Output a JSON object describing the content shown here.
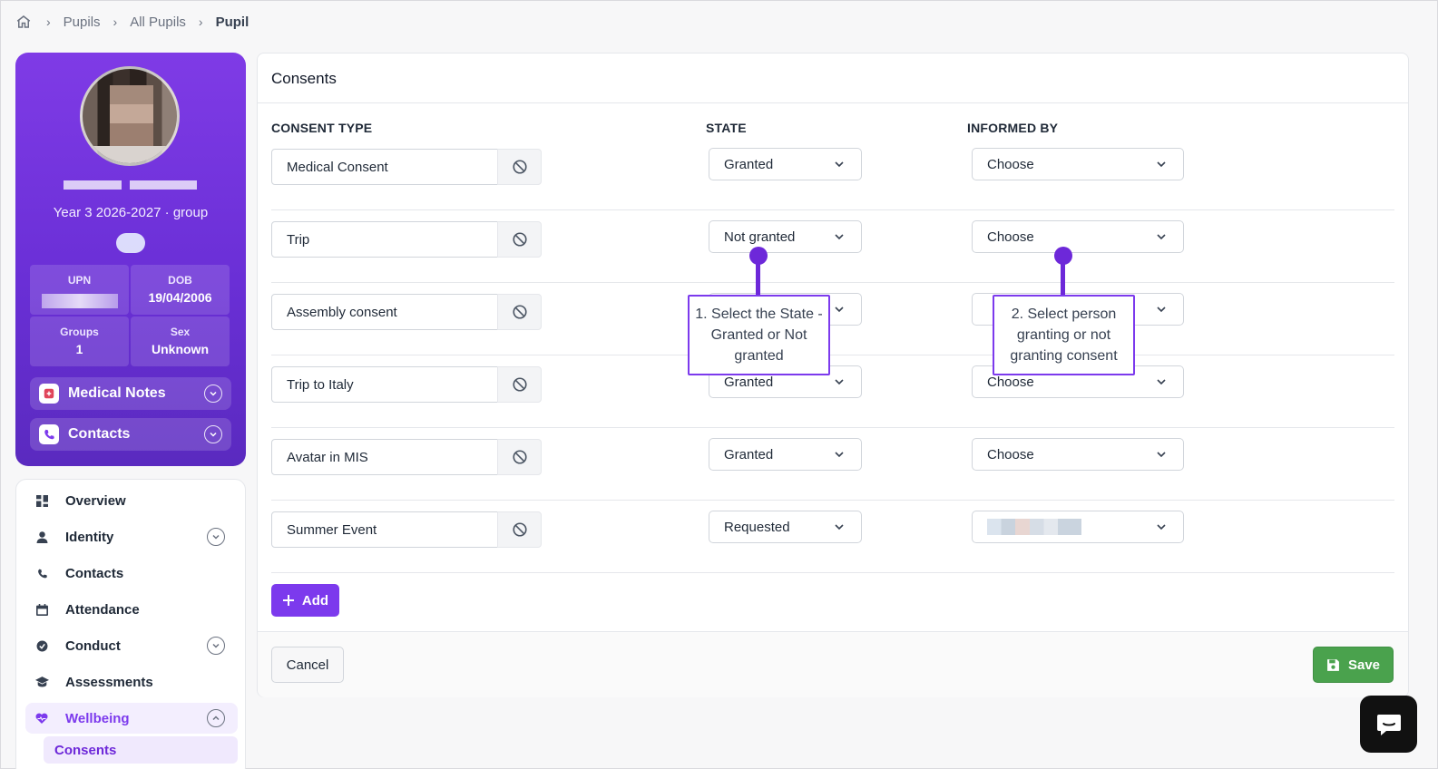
{
  "breadcrumb": {
    "items": [
      "Pupils",
      "All Pupils",
      "Pupil"
    ]
  },
  "profile": {
    "group": "Year 3 2026-2027 · group",
    "upn_label": "UPN",
    "dob_label": "DOB",
    "dob_value": "19/04/2006",
    "groups_label": "Groups",
    "groups_value": "1",
    "sex_label": "Sex",
    "sex_value": "Unknown",
    "medical_notes": "Medical Notes",
    "contacts": "Contacts"
  },
  "nav": {
    "items": [
      {
        "label": "Overview"
      },
      {
        "label": "Identity"
      },
      {
        "label": "Contacts"
      },
      {
        "label": "Attendance"
      },
      {
        "label": "Conduct"
      },
      {
        "label": "Assessments"
      },
      {
        "label": "Wellbeing"
      }
    ],
    "sub_item": "Consents"
  },
  "panel": {
    "title": "Consents",
    "columns": {
      "type": "CONSENT TYPE",
      "state": "STATE",
      "informed": "INFORMED BY"
    },
    "rows": [
      {
        "type": "Medical Consent",
        "state": "Granted",
        "informed": "Choose"
      },
      {
        "type": "Trip",
        "state": "Not granted",
        "informed": "Choose"
      },
      {
        "type": "Assembly consent",
        "state": "",
        "informed": ""
      },
      {
        "type": "Trip to Italy",
        "state": "Granted",
        "informed": "Choose"
      },
      {
        "type": "Avatar in MIS",
        "state": "Granted",
        "informed": "Choose"
      },
      {
        "type": "Summer Event",
        "state": "Requested",
        "informed": ""
      }
    ],
    "add_label": "Add",
    "cancel_label": "Cancel",
    "save_label": "Save"
  },
  "callouts": {
    "state": "1. Select the State - Granted or Not granted",
    "person": "2. Select person granting or not granting consent"
  },
  "colors": {
    "accent": "#7c3aed",
    "save": "#4aa24d"
  }
}
